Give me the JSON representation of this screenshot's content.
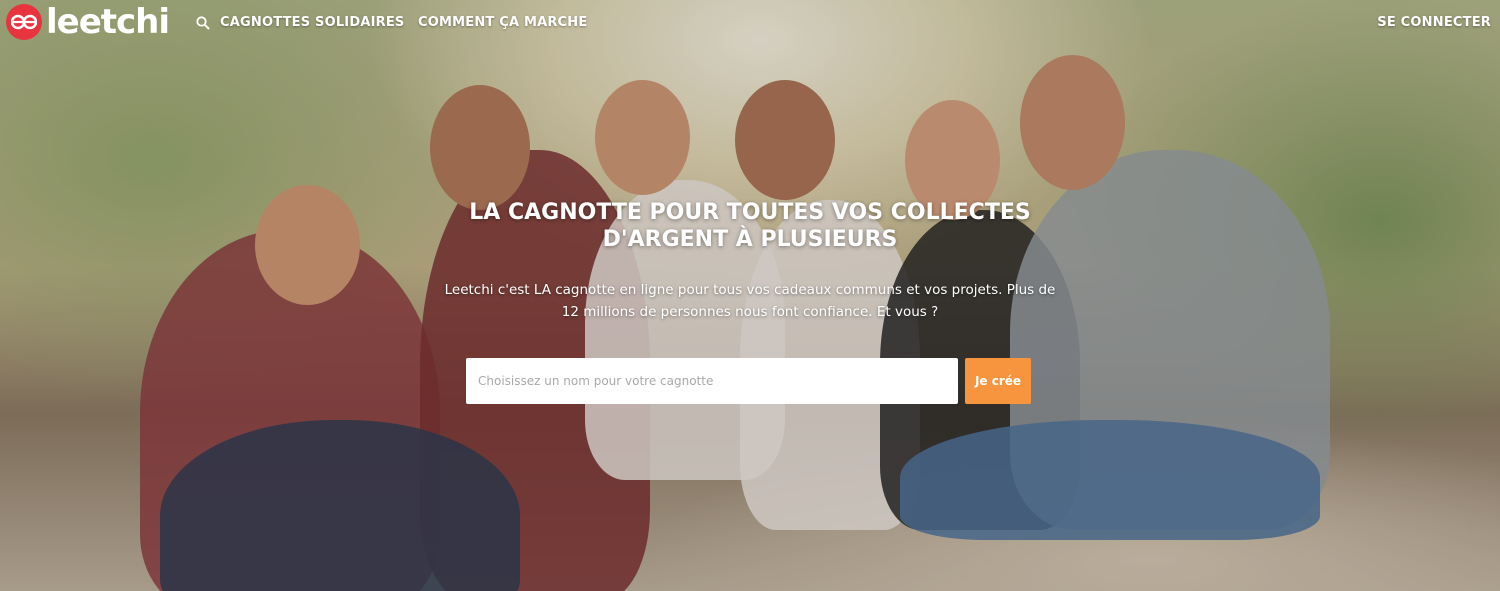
{
  "header": {
    "logo_text": "leetchi",
    "nav": {
      "solidarity_label": "CAGNOTTES SOLIDAIRES",
      "how_label": "COMMENT ÇA MARCHE",
      "login_label": "SE CONNECTER"
    },
    "icons": {
      "search": "search-icon",
      "logo": "leetchi-logo-icon"
    }
  },
  "hero": {
    "title_line1": "LA CAGNOTTE POUR TOUTES VOS COLLECTES",
    "title_line2": "D'ARGENT À PLUSIEURS",
    "subtitle_line1": "Leetchi c'est LA cagnotte en ligne pour tous vos cadeaux communs et vos projets. Plus de",
    "subtitle_line2": "12 millions de personnes nous font confiance. Et vous ?",
    "input": {
      "value": "",
      "placeholder": "Choisissez un nom pour votre cagnotte"
    },
    "create_label": "Je crée"
  },
  "colors": {
    "brand_red": "#e8343f",
    "cta_orange": "#f7953f",
    "text_white": "#ffffff"
  }
}
